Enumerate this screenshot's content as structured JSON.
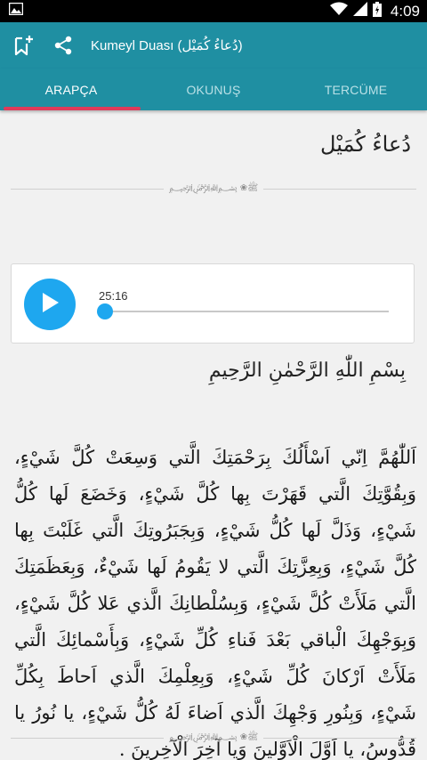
{
  "status_bar": {
    "time": "4:09",
    "icons": [
      "image-notification-icon",
      "wifi-icon",
      "signal-icon",
      "battery-icon"
    ]
  },
  "app_bar": {
    "title": "Kumeyl Duası (دُعاءُ كُمَيْل)",
    "icons": [
      "bookmark-add-icon",
      "share-icon"
    ]
  },
  "tabs": [
    {
      "label": "ARAPÇA",
      "active": true
    },
    {
      "label": "OKUNUŞ",
      "active": false
    },
    {
      "label": "TERCÜME",
      "active": false
    }
  ],
  "content": {
    "heading": "دُعاءُ كُمَيْل",
    "divider_ornament": "ﷺ❀ ﷽",
    "player": {
      "time": "25:16",
      "progress": 0.02
    },
    "basmala": "بِسْمِ اللّٰهِ الرَّحْمٰنِ الرَّحِيمِ",
    "text": "اَللّٰهُمَّ اِنّي اَسْأَلُكَ بِرَحْمَتِكَ الَّتي وَسِعَتْ كُلَّ شَيْءٍ، وَبِقُوَّتِكَ الَّتي قَهَرْتَ بِها كُلَّ شَيْءٍ، وَخَضَعَ لَها كُلُّ شَيْءٍ، وَذَلَّ لَها كُلُّ شَيْءٍ، وَبِجَبَرُوتِكَ الَّتي غَلَبْتَ بِها كُلَّ شَيْءٍ، وَبِعِزَّتِكَ الَّتي لا يَقُومُ لَها شَيْءٌ، وَبِعَظَمَتِكَ الَّتي مَلَأَتْ كُلَّ شَيْءٍ، وَبِسُلْطانِكَ الَّذي عَلا كُلَّ شَيْءٍ، وَبِوَجْهِكَ الْباقي بَعْدَ فَناءِ كُلِّ شَيْءٍ، وَبِأَسْمائِكَ الَّتي مَلَأَتْ اَرْكانَ كُلِّ شَيْءٍ، وَبِعِلْمِكَ الَّذي اَحاطَ بِكُلِّ شَيْءٍ، وَبِنُورِ وَجْهِكَ الَّذي اَضاءَ لَهُ كُلُّ شَيْءٍ، يا نُورُ يا قُدُّوسُ، يا اَوَّلَ الْاَوَّلينَ وَيا آخِرَ الْآخِرينَ ."
  }
}
